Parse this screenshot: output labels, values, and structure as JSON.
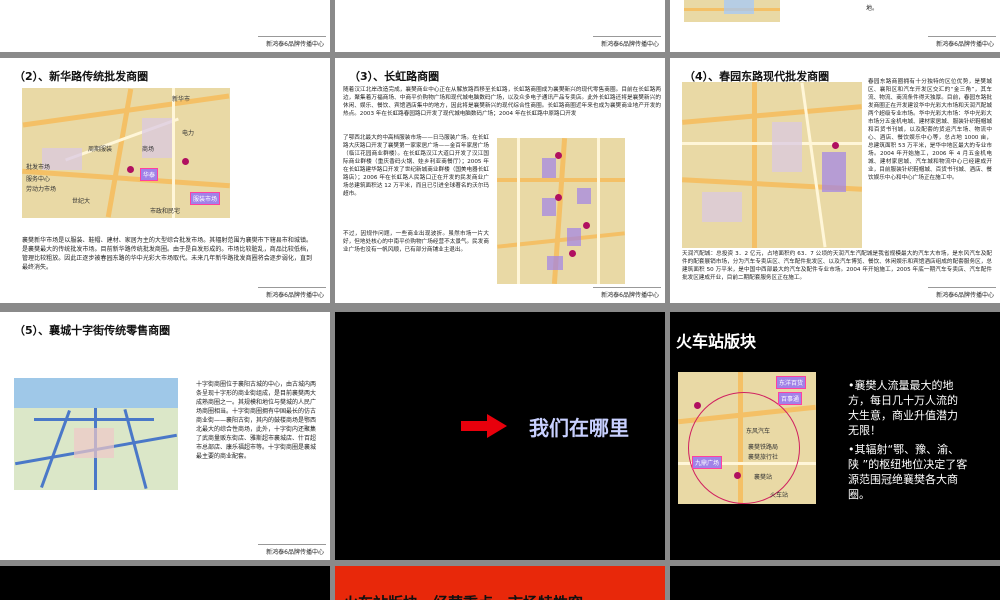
{
  "footer_text": "新鸿泰6品牌传播中心",
  "top_right_fragment": "地。",
  "s2": {
    "title": "（2）、新华路传统批发商圈",
    "body": "襄樊新华市场是以服装、鞋帽、建材、家居为主的大型综合批发市场。其辐射范围为襄樊市下辖县市和城镇。是襄樊最大的传统批发市场。目前新华路传统批发商圈。由于是自发形成的。市场比较脏乱，商品比较低档，管理比较粗放。因此正逐步被春园东路的华中光彩大市场取代。未来几年新华路批发商圈将会逐步弱化，直到最终消失。",
    "map_labels": [
      "新华市",
      "华泰",
      "服装市场",
      "周期服装",
      "批发市场",
      "劳动力市场",
      "世纪大",
      "服务中心",
      "商场",
      "电力",
      "市政和民宅"
    ]
  },
  "s3": {
    "title": "（3）、长虹路商圈",
    "intro": "随着汉江北岸改造完成，襄樊商业中心正在从解放路西移至长虹路，长虹路商圈成为襄樊新兴的现代零售商圈。目前在长虹路两边，聚集着万福商场、中商平价购物广场和现代城电脑数码广场，以及众多电子通讯产品专卖店。此外长虹路还将是襄樊新兴的休闲、娱乐、餐饮、宾馆酒店集中的地方，因此将是襄樊新兴的现代综合性商圈。长虹路商圈近年来也成为襄樊商业地产开发的热点。2003 年在长虹路春园路口开发了现代城电脑数码广场；2004 年在长虹路中原路口开发",
    "left": "了鄂西北最大的中高档服装市场——日马服装广场。在长虹路大庆路口开发了襄樊第一家家居广场——金百年家居广场（临江花园商业群楼）。在长虹路汉江大道口开发了汉江国际商业群楼（重庆香码火锅、娃乡利亚商餐厅）；2005 年在长虹路建华路口开发了世纪新城商业群楼（国美电器长虹路店）；2006 年在长虹路人民路口正在开发的民发商业广场总建筑面积达 12 万平米，而且已引进全球著名的沃尔玛超市。",
    "left2": "不过，因规作问题，一些商业出现波折。虽然市场一片大好，但地处核心的中南平价购物广场经营不太景气。民发商业广场也没有一帆风顺，已有部分商铺业主退出。"
  },
  "s4": {
    "title": "（4）、春园东路现代批发商圈",
    "right": "春园东路商圈拥有十分独特的区位优势，是樊城区、襄阳区和汽车开发区交汇的“金三角”，其车流、物流、商流条件得天独厚。目前，春园东路批发商圈正在开发建设华中光彩大市场和天润汽配城两个超级专业市场。华中光彩大市场：华中光彩大市场分五金机电城、建材家居城、服装针织鞋帽城和百货书刊城，以及配套的货运汽车场、物流中心、酒店、餐饮娱乐中心等，总占地 1000 亩，总建筑面积 53 万平米，是华中地区最大的专业市场。2004 年开始施工，2006 年 4 月五金机电城、建材家居城、汽车城和物流中心已经建成开业，目前服装针织鞋帽城、百货书刊城、酒店、餐饮娱乐中心和中心广场正在施工中。",
    "bottom": "天润汽配城：总投资 3．2 亿元，占地面积约 63．7 公顷的天润汽车汽配城是我省规模最大的汽车大市场，是东风汽车及配件的配套展销市场，分为汽车专卖店区、汽车配件批发区、以及汽车博览、餐饮、休闲娱乐和宾馆酒店组成的配套服务区，总建筑面积 50 万平米，是中国中西部最大的汽车及配件专业市场。2004 年开始施工，2005 年底一期汽车专卖店、汽车配件批发区建成开业，目前二期配套服务区正在施工。"
  },
  "s5": {
    "title": "（5）、襄城十字街传统零售商圈",
    "body": "十字街商圈位于襄阳古城的中心，由古城内两条呈现十字形的商业街组成，是目前襄樊两大成熟商圈之一。其规模和地位与樊城的人民广场商圈相当。十字街商圈拥有中国最长的仿古商业街——襄阳古街，其内的鼓楼商场是鄂西北最大的综合性商场，此外，十字街内还聚集了武商量贩东街店、雅斯超市襄城店、什百超市总部店、康乐福超市等。十字街商圈是襄城最主要的商业配套。"
  },
  "s6": {
    "question": "我们在哪里"
  },
  "s7": {
    "title": "火车站版块",
    "bullets": [
      "•襄樊人流量最大的地方，每日几十万人流的大生意，商业升值潜力无限！",
      "•其辐射“鄂、豫、渝、陕 ”的枢纽地位决定了客源范围冠绝襄樊各大商圈。"
    ],
    "map_labels": [
      "东洋百货",
      "百事通",
      "九鼎广场",
      "东风汽车",
      "襄樊铁路局",
      "襄樊旅行社",
      "襄樊站",
      "火车站"
    ]
  },
  "s9": {
    "title": "火车站版块，经营重点，市场特性突"
  },
  "colors": {
    "background": "#8a8a8a",
    "slide_red": "#e8280a",
    "arrow_red": "#e8000c",
    "question_text": "#c8d0ff"
  }
}
